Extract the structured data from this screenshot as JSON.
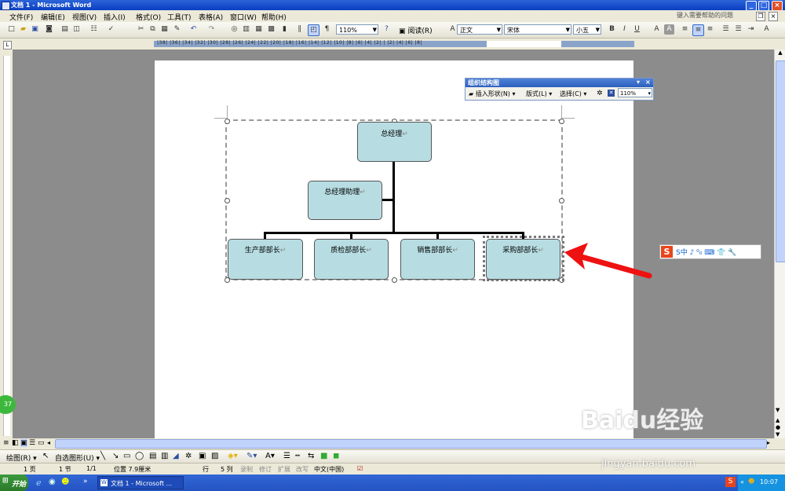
{
  "window": {
    "title": "文档 1 - Microsoft Word",
    "minimize": "_",
    "maximize": "□",
    "close": "×"
  },
  "menubar": {
    "items": [
      "文件(F)",
      "编辑(E)",
      "视图(V)",
      "插入(I)",
      "格式(O)",
      "工具(T)",
      "表格(A)",
      "窗口(W)",
      "帮助(H)"
    ],
    "help_placeholder": "键入需要帮助的问题"
  },
  "toolbar": {
    "zoom": "110%",
    "read_label": "阅读(R)",
    "style": "正文",
    "font": "宋体",
    "size": "小五",
    "bold": "B",
    "italic": "I",
    "underline": "U"
  },
  "ruler": {
    "ticks": "|38| |36| |34| |32| |30| |28| |26| |24| |22| |20| |18| |16| |14| |12| |10| |8| |6| |4| |2| | |2| |4| |6| |8|"
  },
  "org_chart": {
    "top": "总经理",
    "assistant": "总经理助理",
    "departments": [
      "生产部部长",
      "质检部部长",
      "销售部部长",
      "采购部部长"
    ],
    "para_mark": "↵"
  },
  "org_toolbar": {
    "title": "组织结构图",
    "insert_shape": "插入形状(N)",
    "layout": "版式(L)",
    "select": "选择(C)",
    "zoom": "110%"
  },
  "ime": {
    "label": "S中 ♪ ⁰₀ ⌨ 👕 🔧"
  },
  "drawbar": {
    "draw_label": "绘图(R)",
    "autoshape_label": "自选图形(U)"
  },
  "statusbar": {
    "page": "1 页",
    "section": "1 节",
    "pages": "1/1",
    "position": "位置 7.9厘米",
    "line": "行",
    "column": "5 列",
    "rec": "录制",
    "trk": "修订",
    "ext": "扩展",
    "ovr": "改写",
    "lang": "中文(中国)"
  },
  "taskbar": {
    "start": "开始",
    "task": "文档 1 - Microsoft ...",
    "clock": "10:07",
    "more": "»"
  },
  "badge": {
    "value": "37"
  },
  "watermark": {
    "brand": "Baidu经验",
    "url": "jingyan.baidu.com"
  }
}
